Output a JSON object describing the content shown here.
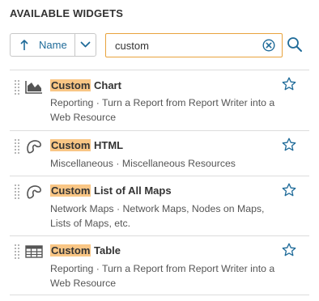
{
  "panel": {
    "title": "AVAILABLE WIDGETS"
  },
  "sort": {
    "label": "Name",
    "direction_icon": "arrow-up-icon",
    "dropdown_icon": "chevron-down-icon"
  },
  "search": {
    "value": "custom",
    "placeholder": "",
    "clear_icon": "clear-circle-icon",
    "search_icon": "search-icon"
  },
  "colors": {
    "accent": "#1f6b99",
    "highlight": "#f9c685",
    "search_border": "#e8a33d"
  },
  "widgets": [
    {
      "icon": "area-chart-icon",
      "highlight": "Custom",
      "title_rest": " Chart",
      "description": "Reporting · Turn a Report from Report Writer into a Web Resource"
    },
    {
      "icon": "html-blob-icon",
      "highlight": "Custom",
      "title_rest": " HTML",
      "description": "Miscellaneous · Miscellaneous Resources"
    },
    {
      "icon": "map-blob-icon",
      "highlight": "Custom",
      "title_rest": " List of All Maps",
      "description": "Network Maps · Network Maps, Nodes on Maps, Lists of Maps, etc."
    },
    {
      "icon": "table-grid-icon",
      "highlight": "Custom",
      "title_rest": " Table",
      "description": "Reporting · Turn a Report from Report Writer into a Web Resource"
    }
  ]
}
